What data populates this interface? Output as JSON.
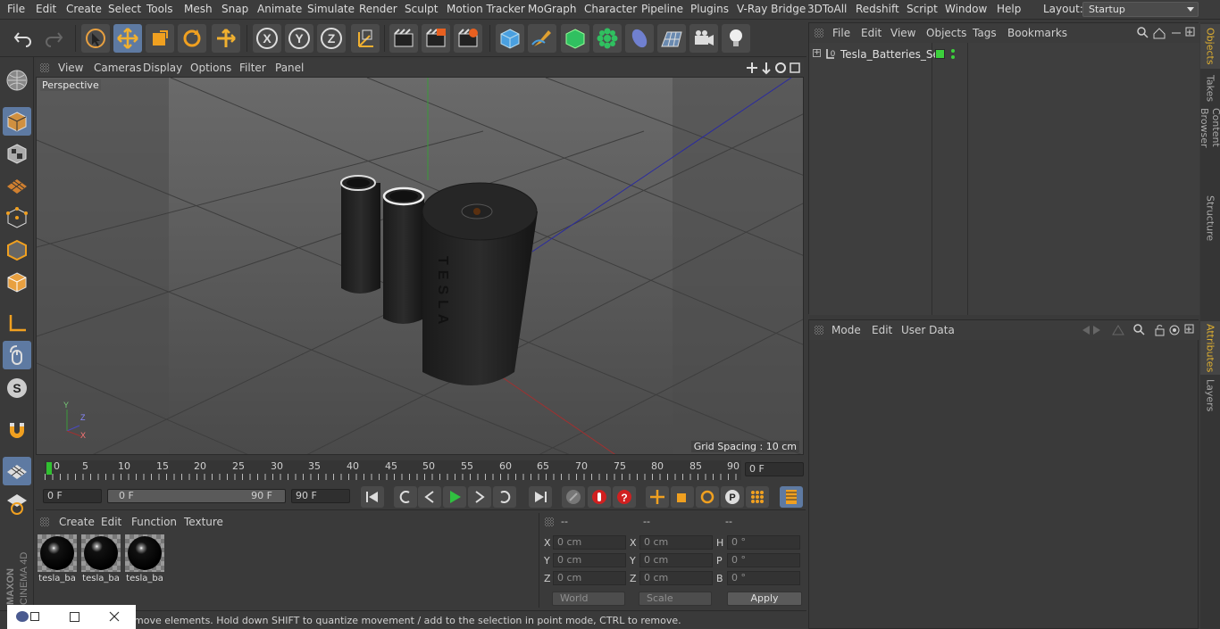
{
  "menu": {
    "items": [
      "File",
      "Edit",
      "Create",
      "Select",
      "Tools",
      "Mesh",
      "Snap",
      "Animate",
      "Simulate",
      "Render",
      "Sculpt",
      "Motion Tracker",
      "MoGraph",
      "Character",
      "Pipeline",
      "Plugins",
      "V-Ray Bridge",
      "3DToAll",
      "Redshift",
      "Script",
      "Window",
      "Help"
    ],
    "layout_label": "Layout:",
    "layout_value": "Startup"
  },
  "toolbar_icons": [
    "undo-icon",
    "redo-icon",
    "live-selection-icon",
    "move-icon",
    "scale-icon",
    "rotate-icon",
    "last-tool-icon",
    "x-axis-icon",
    "y-axis-icon",
    "z-axis-icon",
    "coordinate-system-icon",
    "render-view-icon",
    "render-picture-viewer-icon",
    "edit-render-settings-icon",
    "cube-icon",
    "pen-icon",
    "subdivision-icon",
    "cloner-icon",
    "deformer-icon",
    "floor-icon",
    "camera-icon",
    "light-icon"
  ],
  "viewport": {
    "menu": [
      "View",
      "Cameras",
      "Display",
      "Options",
      "Filter",
      "Panel"
    ],
    "label": "Perspective",
    "grid_spacing": "Grid Spacing : 10 cm",
    "embossed_text": "TESLA"
  },
  "timeline": {
    "ticks": [
      "0",
      "5",
      "10",
      "15",
      "20",
      "25",
      "30",
      "35",
      "40",
      "45",
      "50",
      "55",
      "60",
      "65",
      "70",
      "75",
      "80",
      "85",
      "90"
    ],
    "current_frame": "0 F"
  },
  "transport": {
    "start_field": "0 F",
    "range_start": "0 F",
    "range_end": "90 F",
    "end_field": "90 F"
  },
  "materials": {
    "menu": [
      "Create",
      "Edit",
      "Function",
      "Texture"
    ],
    "items": [
      {
        "name": "tesla_ba"
      },
      {
        "name": "tesla_ba"
      },
      {
        "name": "tesla_ba"
      }
    ]
  },
  "coordinates": {
    "headers": [
      "--",
      "--",
      "--"
    ],
    "rows": [
      {
        "l1": "X",
        "v1": "0 cm",
        "l2": "X",
        "v2": "0 cm",
        "l3": "H",
        "v3": "0 °"
      },
      {
        "l1": "Y",
        "v1": "0 cm",
        "l2": "Y",
        "v2": "0 cm",
        "l3": "P",
        "v3": "0 °"
      },
      {
        "l1": "Z",
        "v1": "0 cm",
        "l2": "Z",
        "v2": "0 cm",
        "l3": "B",
        "v3": "0 °"
      }
    ],
    "mode_dropdown": "World",
    "scale_dropdown": "Scale",
    "apply_label": "Apply"
  },
  "objects": {
    "menu": [
      "File",
      "Edit",
      "View",
      "Objects",
      "Tags",
      "Bookmarks"
    ],
    "items": [
      {
        "name": "Tesla_Batteries_Set"
      }
    ]
  },
  "attributes": {
    "menu": [
      "Mode",
      "Edit",
      "User Data"
    ]
  },
  "side_tabs": [
    "Objects",
    "Takes",
    "Content Browser",
    "Structure",
    "Attributes",
    "Layers"
  ],
  "status": {
    "text": "move elements. Hold down SHIFT to quantize movement / add to the selection in point mode, CTRL to remove."
  },
  "brand": {
    "line1": "MAXON",
    "line2": "CINEMA 4D"
  },
  "colors": {
    "accent": "#5e7aa2",
    "active_tab": "#e0b030",
    "green_dot": "#3cd03c"
  }
}
